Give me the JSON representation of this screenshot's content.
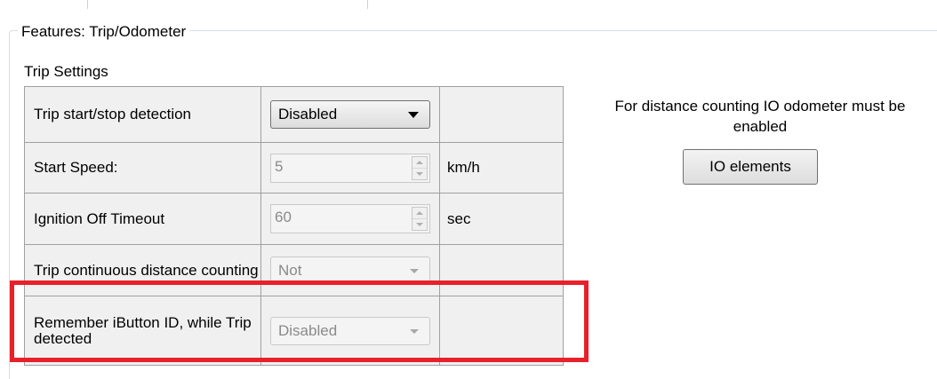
{
  "group_title": "Features: Trip/Odometer",
  "section_title": "Trip Settings",
  "rows": [
    {
      "label": "Trip start/stop detection",
      "control": "combo",
      "value": "Disabled",
      "enabled": true,
      "unit": ""
    },
    {
      "label": "Start Speed:",
      "control": "spin",
      "value": "5",
      "enabled": false,
      "unit": "km/h"
    },
    {
      "label": "Ignition Off Timeout",
      "control": "spin",
      "value": "60",
      "enabled": false,
      "unit": "sec"
    },
    {
      "label": "Trip continuous distance counting",
      "control": "combo",
      "value": "Not",
      "enabled": false,
      "unit": ""
    },
    {
      "label": "Remember iButton ID, while Trip detected",
      "control": "combo",
      "value": "Disabled",
      "enabled": false,
      "unit": ""
    }
  ],
  "note": "For distance counting IO odometer must be enabled",
  "io_button_label": "IO elements",
  "colors": {
    "highlight": "#e8202a",
    "table_bg": "#f0f0f0",
    "border": "#a0a0a0"
  },
  "icons": [
    "dropdown-arrow-icon",
    "spin-up-icon",
    "spin-down-icon"
  ]
}
